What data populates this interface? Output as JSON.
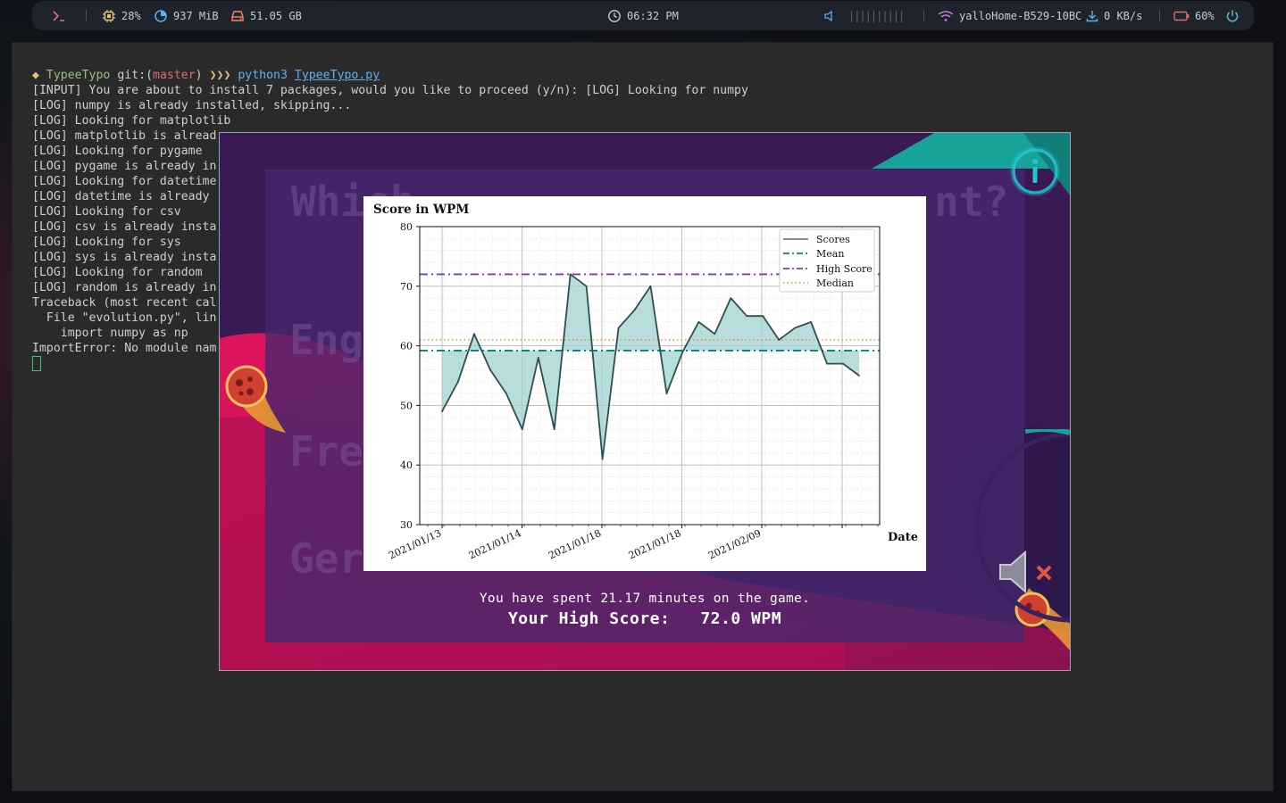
{
  "topbar": {
    "cpu": "28%",
    "ram": "937 MiB",
    "disk": "51.05 GB",
    "clock": "06:32 PM",
    "volume_bar": "||||||||||",
    "wifi": "yalloHome-B529-10BC",
    "net_speed": "0 KB/s",
    "battery": "60%",
    "icons": [
      "terminal-prompt-icon",
      "cpu-icon",
      "ram-pie-icon",
      "disk-icon",
      "clock-icon",
      "volume-icon",
      "wifi-icon",
      "download-icon",
      "battery-icon",
      "power-icon"
    ],
    "accent_colors": {
      "cpu": "#e5c07b",
      "ram": "#61afef",
      "disk": "#f08a5d",
      "battery": "#e06c75",
      "wifi": "#c678dd",
      "power": "#56b6c2"
    }
  },
  "terminal": {
    "prompt": {
      "symbol": "◆",
      "dir": "TypeeTypo",
      "git_prefix": "git:(",
      "branch": "master",
      "git_suffix": ")",
      "arrows": "❯❯❯",
      "cmd": "python3",
      "file": "TypeeTypo.py"
    },
    "lines": [
      "[INPUT] You are about to install 7 packages, would you like to proceed (y/n): [LOG] Looking for numpy",
      "[LOG] numpy is already installed, skipping...",
      "[LOG] Looking for matplotlib",
      "[LOG] matplotlib is alread",
      "[LOG] Looking for pygame",
      "[LOG] pygame is already in",
      "[LOG] Looking for datetime",
      "[LOG] datetime is already",
      "[LOG] Looking for csv",
      "[LOG] csv is already insta",
      "[LOG] Looking for sys",
      "[LOG] sys is already insta",
      "[LOG] Looking for random",
      "[LOG] random is already in",
      "Traceback (most recent cal",
      "  File \"evolution.py\", lin",
      "    import numpy as np",
      "ImportError: No module nam"
    ]
  },
  "game": {
    "ghost_words": [
      "Which",
      "nt?",
      "Eng",
      "Fre",
      "Ger"
    ],
    "time_message": "You have spent 21.17 minutes on the game.",
    "high_score_message": "Your High Score:   72.0 WPM",
    "colors": {
      "background": "#3b1a52",
      "panel": "#46286e",
      "accent_pink": "#d6145a",
      "accent_teal": "#17a39a"
    }
  },
  "chart_data": {
    "type": "line",
    "title": "Score in WPM",
    "xlabel": "Date",
    "ylabel": "",
    "ylim": [
      30,
      80
    ],
    "yticks": [
      30,
      40,
      50,
      60,
      70,
      80
    ],
    "xtick_labels": [
      "2021/01/13",
      "2021/01/14",
      "2021/01/18",
      "2021/01/18",
      "2021/02/09"
    ],
    "grid": true,
    "legend_position": "top-right",
    "values": [
      49,
      54,
      62,
      56,
      52,
      46,
      58,
      46,
      72,
      70,
      41,
      63,
      66,
      70,
      52,
      59,
      64,
      62,
      68,
      65,
      65,
      61,
      63,
      64,
      57,
      57,
      55
    ],
    "series": [
      {
        "name": "Scores",
        "style": "solid",
        "color": "#2f4f4f",
        "fill": "#9fd3d0"
      },
      {
        "name": "Mean",
        "style": "dashdot",
        "value": 59.2,
        "color": "#008080"
      },
      {
        "name": "High Score",
        "style": "dashdot",
        "value": 72.0,
        "color": "#7b3fa0"
      },
      {
        "name": "Median",
        "style": "dotted",
        "value": 61.0,
        "color": "#e08a3c"
      }
    ]
  }
}
